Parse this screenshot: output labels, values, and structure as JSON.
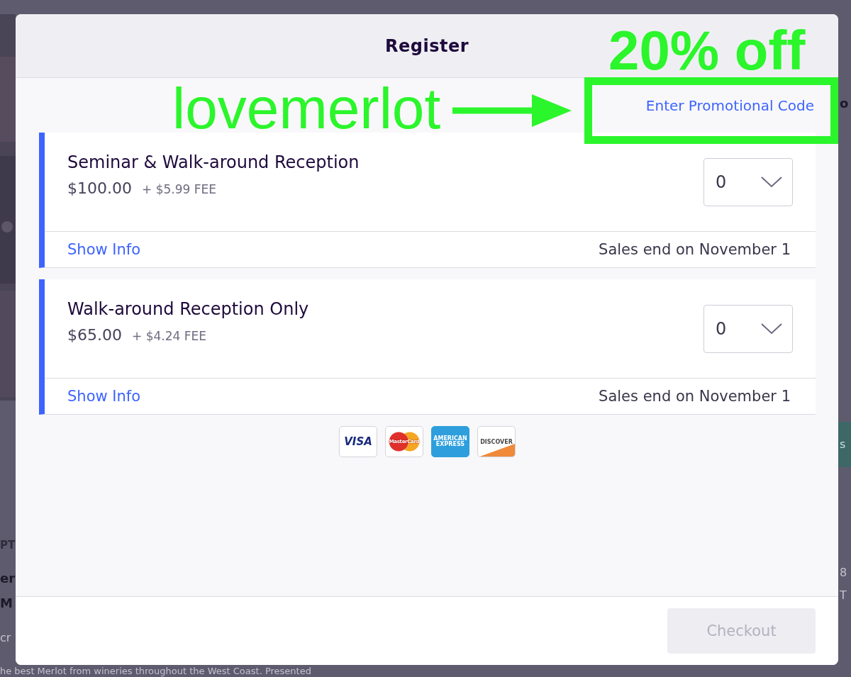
{
  "background_page": {
    "fragments_left": [
      {
        "kind": "label",
        "text": "PT"
      },
      {
        "kind": "heading",
        "text": "er"
      },
      {
        "kind": "heading",
        "text": "M"
      },
      {
        "kind": "body",
        "text": "cr"
      }
    ],
    "description": "he best Merlot from wineries throughout the West Coast. Presented",
    "fragments_right": [
      {
        "kind": "heading",
        "text": "o"
      },
      {
        "kind": "button",
        "text": "s"
      },
      {
        "kind": "body",
        "text": "8"
      },
      {
        "kind": "body",
        "text": "T"
      }
    ]
  },
  "modal": {
    "title": "Register",
    "promo_link": "Enter Promotional Code",
    "tickets": [
      {
        "name": "Seminar & Walk-around Reception",
        "price": "$100.00",
        "fee": "+ $5.99 FEE",
        "quantity": "0",
        "info_link": "Show Info",
        "sales_end": "Sales end on November 1"
      },
      {
        "name": "Walk-around Reception Only",
        "price": "$65.00",
        "fee": "+ $4.24 FEE",
        "quantity": "0",
        "info_link": "Show Info",
        "sales_end": "Sales end on November 1"
      }
    ],
    "payment_cards": [
      {
        "kind": "visa",
        "text": "VISA"
      },
      {
        "kind": "mastercard",
        "text": "MasterCard"
      },
      {
        "kind": "amex",
        "text": "AMERICAN EXPRESS"
      },
      {
        "kind": "discover",
        "text": "DISCOVER"
      }
    ],
    "checkout_button": {
      "label": "Checkout",
      "disabled": true
    }
  },
  "annotations": {
    "code": "lovemerlot",
    "discount": "20% off"
  }
}
